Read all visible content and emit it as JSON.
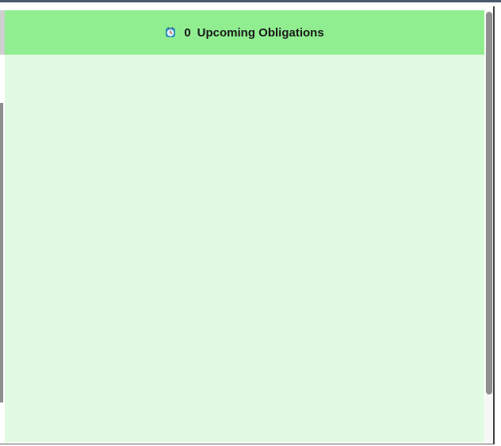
{
  "panel": {
    "header": {
      "icon": "alarm-clock-icon",
      "count": "0",
      "title": "Upcoming Obligations"
    }
  },
  "colors": {
    "header_bg": "#90ee90",
    "body_bg": "#e2f9e2",
    "icon_face": "#3aa0d0"
  }
}
